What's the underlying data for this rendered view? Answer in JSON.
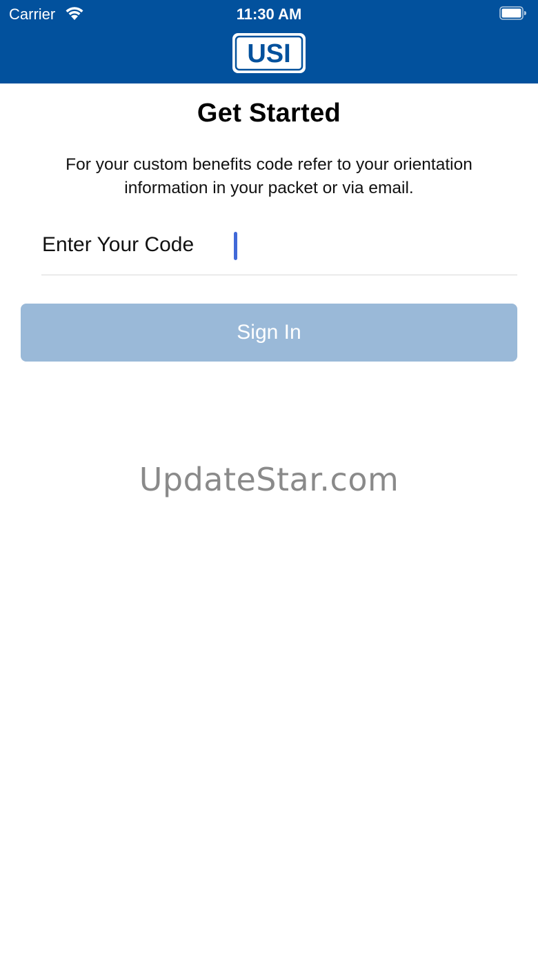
{
  "status_bar": {
    "carrier": "Carrier",
    "time": "11:30 AM",
    "wifi_icon": "wifi-icon",
    "battery_icon": "battery-icon"
  },
  "header": {
    "logo_text": "USI",
    "background": "#02519d"
  },
  "main": {
    "title": "Get Started",
    "description": "For your custom benefits code refer to your orientation information in your packet or via email.",
    "code_label": "Enter Your Code",
    "code_value": "",
    "sign_in_label": "Sign In",
    "button_color": "#9ab9d8",
    "caret_color": "#4169d8"
  },
  "watermark": "UpdateStar.com"
}
